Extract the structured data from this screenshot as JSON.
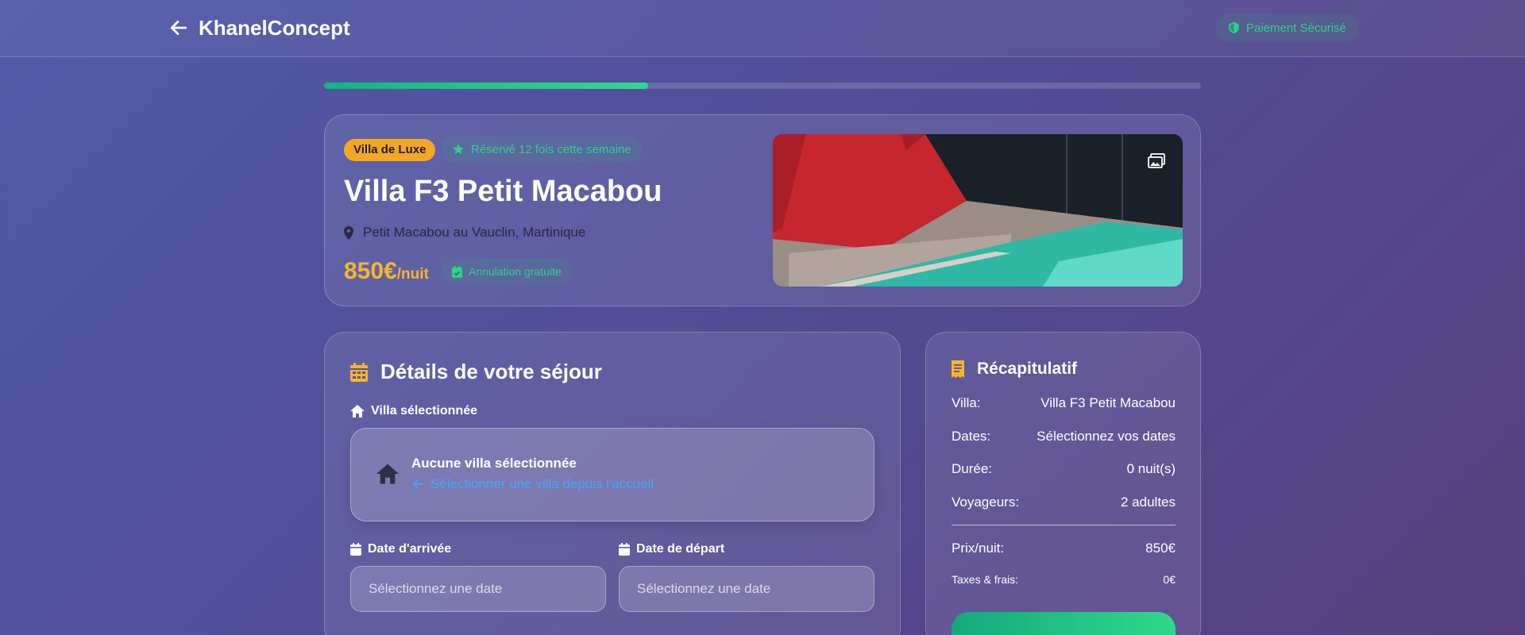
{
  "header": {
    "brand": "KhanelConcept",
    "secure_label": "Paiement Sécurisé"
  },
  "progress": {
    "fraction": 0.37
  },
  "hero": {
    "tag": "Villa de Luxe",
    "booked_badge": "Réservé 12 fois cette semaine",
    "title": "Villa F3 Petit Macabou",
    "location": "Petit Macabou au Vauclin, Martinique",
    "price_amount": "850€",
    "price_unit": "/nuit",
    "cancellation": "Annulation gratuite"
  },
  "details": {
    "title": "Détails de votre séjour",
    "villa_label": "Villa sélectionnée",
    "no_villa": "Aucune villa sélectionnée",
    "select_link": "Sélectionner une villa depuis l'accueil",
    "arrival_label": "Date d'arrivée",
    "departure_label": "Date de départ",
    "arrival_placeholder": "Sélectionnez une date",
    "departure_placeholder": "Sélectionnez une date"
  },
  "summary": {
    "title": "Récapitulatif",
    "rows": [
      {
        "label": "Villa:",
        "value": "Villa F3 Petit Macabou"
      },
      {
        "label": "Dates:",
        "value": "Sélectionnez vos dates"
      },
      {
        "label": "Durée:",
        "value": "0 nuit(s)"
      },
      {
        "label": "Voyageurs:",
        "value": "2 adultes"
      }
    ],
    "price_label": "Prix/nuit:",
    "price_value": "850€",
    "taxes_label": "Taxes & frais:",
    "taxes_value": "0€"
  },
  "colors": {
    "accent_green": "#2fd08a",
    "price_gold": "#f5b52e",
    "link_blue": "#3fa7ff",
    "tag_orange": "#f5a623"
  },
  "icons": [
    "arrow-left-icon",
    "shield-icon",
    "star-icon",
    "map-pin-icon",
    "calendar-check-icon",
    "images-icon",
    "calendar-icon",
    "home-icon",
    "receipt-icon"
  ]
}
